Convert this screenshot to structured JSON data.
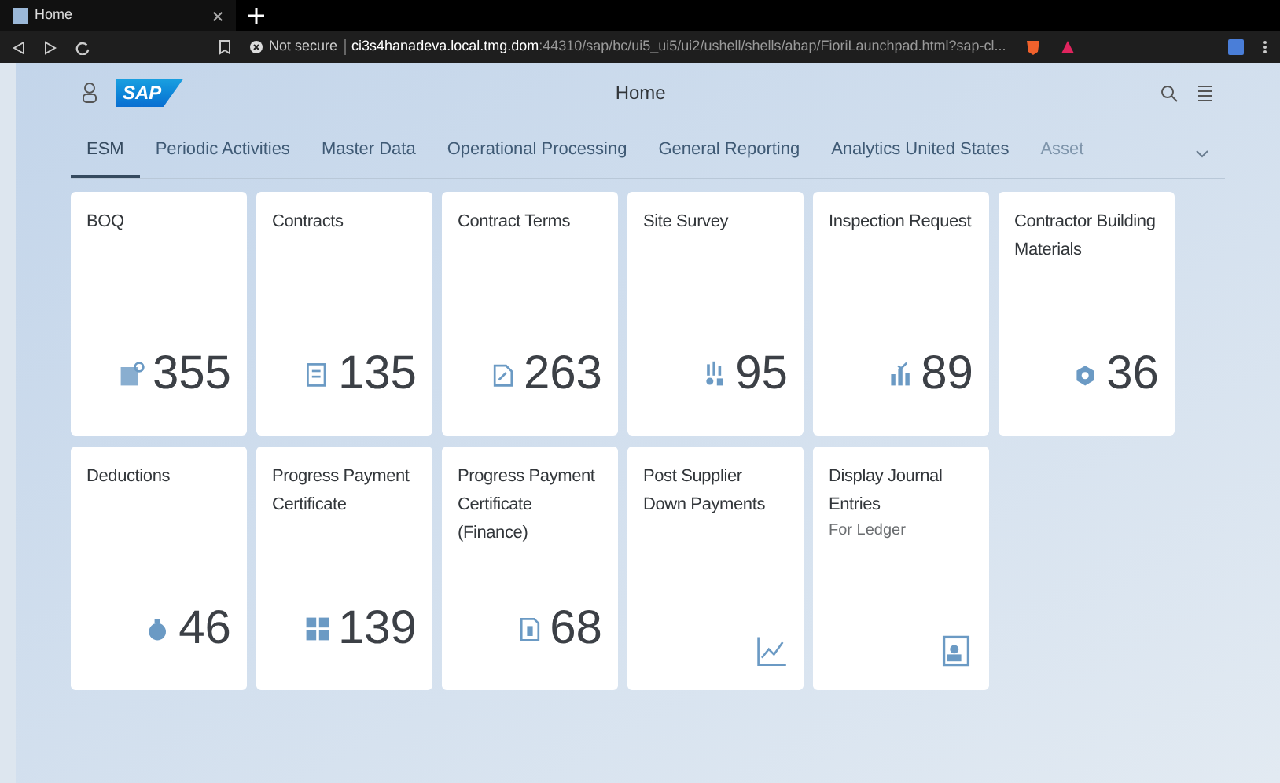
{
  "browser": {
    "tab_title": "Home",
    "security": "Not secure",
    "url_host": "ci3s4hanadeva.local.tmg.dom",
    "url_path": ":44310/sap/bc/ui5_ui5/ui2/ushell/shells/abap/FioriLaunchpad.html?sap-cl..."
  },
  "shell": {
    "logo": "SAP",
    "title": "Home"
  },
  "tabs": [
    {
      "label": "ESM",
      "selected": true,
      "faded": false
    },
    {
      "label": "Periodic Activities",
      "selected": false,
      "faded": false
    },
    {
      "label": "Master Data",
      "selected": false,
      "faded": false
    },
    {
      "label": "Operational Processing",
      "selected": false,
      "faded": false
    },
    {
      "label": "General Reporting",
      "selected": false,
      "faded": false
    },
    {
      "label": "Analytics United States",
      "selected": false,
      "faded": false
    },
    {
      "label": "Asset",
      "selected": false,
      "faded": true
    }
  ],
  "tile_rows": [
    [
      {
        "kind": "number",
        "title": "BOQ",
        "value": "355"
      },
      {
        "kind": "number",
        "title": "Contracts",
        "value": "135"
      },
      {
        "kind": "number",
        "title": "Contract Terms",
        "value": "263"
      },
      {
        "kind": "number",
        "title": "Site Survey",
        "value": "95"
      },
      {
        "kind": "number",
        "title": "Inspection Request",
        "value": "89"
      },
      {
        "kind": "number",
        "title": "Contractor Building Materials",
        "value": "36"
      }
    ],
    [
      {
        "kind": "number",
        "title": "Deductions",
        "value": "46"
      },
      {
        "kind": "number",
        "title": "Progress Payment Certificate",
        "value": "139"
      },
      {
        "kind": "number",
        "title": "Progress Payment Certificate (Finance)",
        "value": "68"
      },
      {
        "kind": "icon",
        "title": "Post Supplier Down Payments"
      },
      {
        "kind": "icon",
        "title": "Display Journal Entries",
        "subtitle": "For Ledger"
      }
    ]
  ]
}
